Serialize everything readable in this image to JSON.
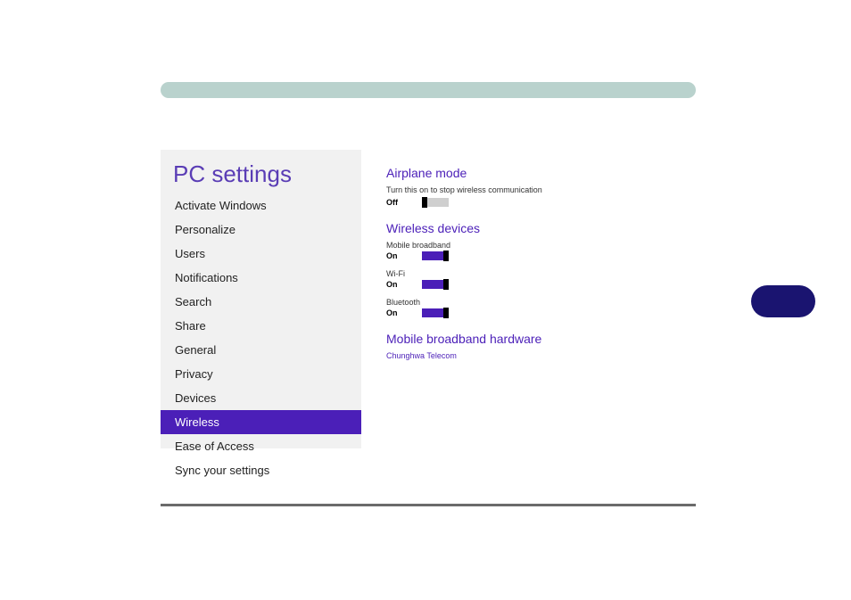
{
  "sidebar": {
    "title": "PC settings",
    "items": [
      {
        "label": "Activate Windows"
      },
      {
        "label": "Personalize"
      },
      {
        "label": "Users"
      },
      {
        "label": "Notifications"
      },
      {
        "label": "Search"
      },
      {
        "label": "Share"
      },
      {
        "label": "General"
      },
      {
        "label": "Privacy"
      },
      {
        "label": "Devices"
      },
      {
        "label": "Wireless"
      },
      {
        "label": "Ease of Access"
      },
      {
        "label": "Sync your settings"
      }
    ],
    "selected_index": 9
  },
  "content": {
    "airplane": {
      "title": "Airplane mode",
      "desc": "Turn this on to stop wireless communication",
      "state": "Off",
      "on": false
    },
    "wireless_devices": {
      "title": "Wireless devices",
      "devices": [
        {
          "label": "Mobile broadband",
          "state": "On",
          "on": true
        },
        {
          "label": "Wi-Fi",
          "state": "On",
          "on": true
        },
        {
          "label": "Bluetooth",
          "state": "On",
          "on": true
        }
      ]
    },
    "mobile_hw": {
      "title": "Mobile broadband hardware",
      "provider": "Chunghwa Telecom"
    }
  }
}
